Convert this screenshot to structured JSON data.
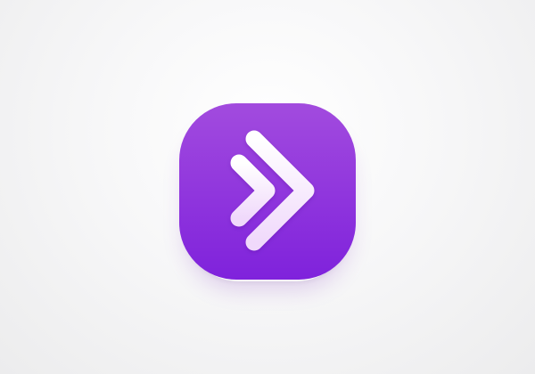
{
  "app_icon": {
    "glyph": "double-chevron-right-icon",
    "colors": {
      "background_top": "#a24bde",
      "background_bottom": "#7f22dc",
      "glyph_top": "#ffffff",
      "glyph_bottom": "#f0d9fb"
    }
  }
}
